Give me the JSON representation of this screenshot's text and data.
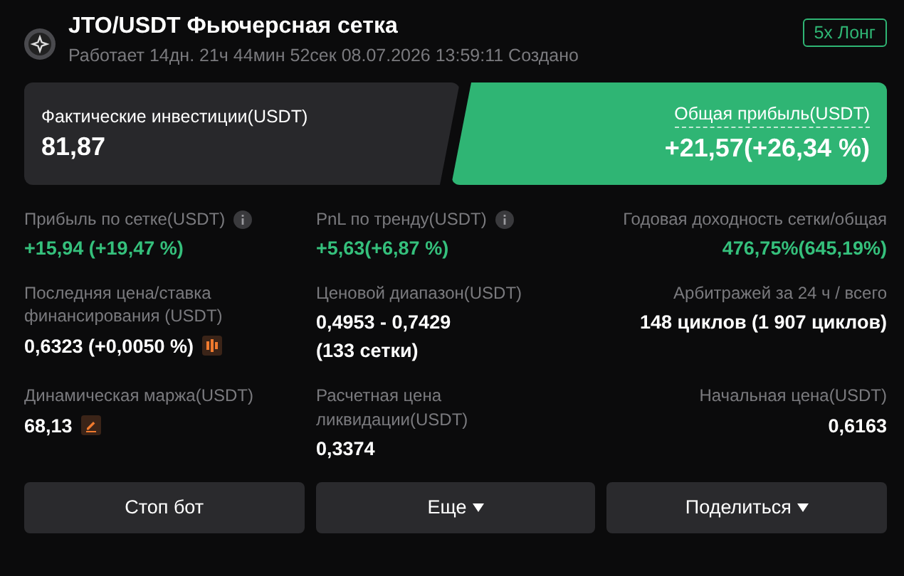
{
  "header": {
    "title": "JTO/USDT Фьючерсная сетка",
    "subtitle": "Работает 14дн. 21ч 44мин 52сек 08.07.2026 13:59:11 Создано",
    "badge": "5x Лонг"
  },
  "cards": [
    {
      "kind": "dark",
      "label": "Фактические инвестиции(USDT)",
      "value": "81,87"
    },
    {
      "kind": "green",
      "label": "Общая прибыль(USDT)",
      "value": "+21,57(+26,34 %)"
    }
  ],
  "stats": [
    {
      "kind": "gaininfo",
      "label": "Прибыль по сетке(USDT)",
      "values": [
        "+15,94 (+19,47 %)"
      ]
    },
    {
      "kind": "gaininfo",
      "label": "PnL по тренду(USDT)",
      "values": [
        "+5,63(+6,87 %)"
      ]
    },
    {
      "kind": "gain",
      "label": "Годовая доходность сетки/общая",
      "values": [
        "476,75%(645,19%)"
      ]
    },
    {
      "kind": "price",
      "label": "Последняя цена/ставка финансирования (USDT)",
      "values": [
        "0,6323 (+0,0050 %)"
      ]
    },
    {
      "kind": "plain",
      "label": "Ценовой диапазон(USDT)",
      "values": [
        "0,4953 - 0,7429",
        "(133 сетки)"
      ]
    },
    {
      "kind": "plain",
      "label": "Арбитражей за 24 ч / всего",
      "values": [
        "148 циклов (1 907 циклов)"
      ]
    },
    {
      "kind": "margin",
      "label": "Динамическая маржа(USDT)",
      "values": [
        "68,13"
      ]
    },
    {
      "kind": "plain",
      "label": "Расчетная цена ликвидации(USDT)",
      "values": [
        "0,3374"
      ]
    },
    {
      "kind": "plain",
      "label": "Начальная цена(USDT)",
      "values": [
        "0,6163"
      ]
    }
  ],
  "buttons": [
    {
      "label": "Стоп бот",
      "caret": false
    },
    {
      "label": "Еще",
      "caret": true
    },
    {
      "label": "Поделиться",
      "caret": true
    }
  ]
}
